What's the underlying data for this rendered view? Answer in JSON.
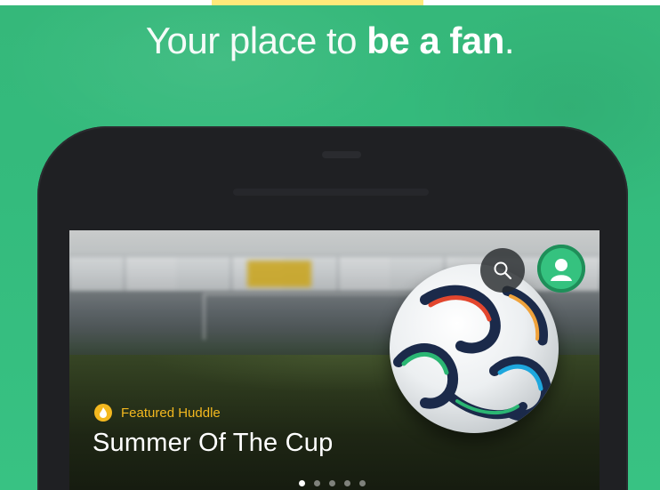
{
  "headline": {
    "prefix": "Your place to ",
    "emphasis": "be a fan",
    "suffix": "."
  },
  "card": {
    "badge_label": "Featured Huddle",
    "title": "Summer Of The Cup",
    "pagination_count": 5,
    "active_page": 1
  },
  "icons": {
    "search": "search-icon",
    "avatar": "user-avatar-icon",
    "featured": "featured-badge-icon"
  },
  "colors": {
    "background": "#35b87a",
    "phone_body": "#1f2023",
    "accent_green": "#35c27f",
    "featured_gold": "#f3b81f",
    "text_white": "#ffffff"
  }
}
